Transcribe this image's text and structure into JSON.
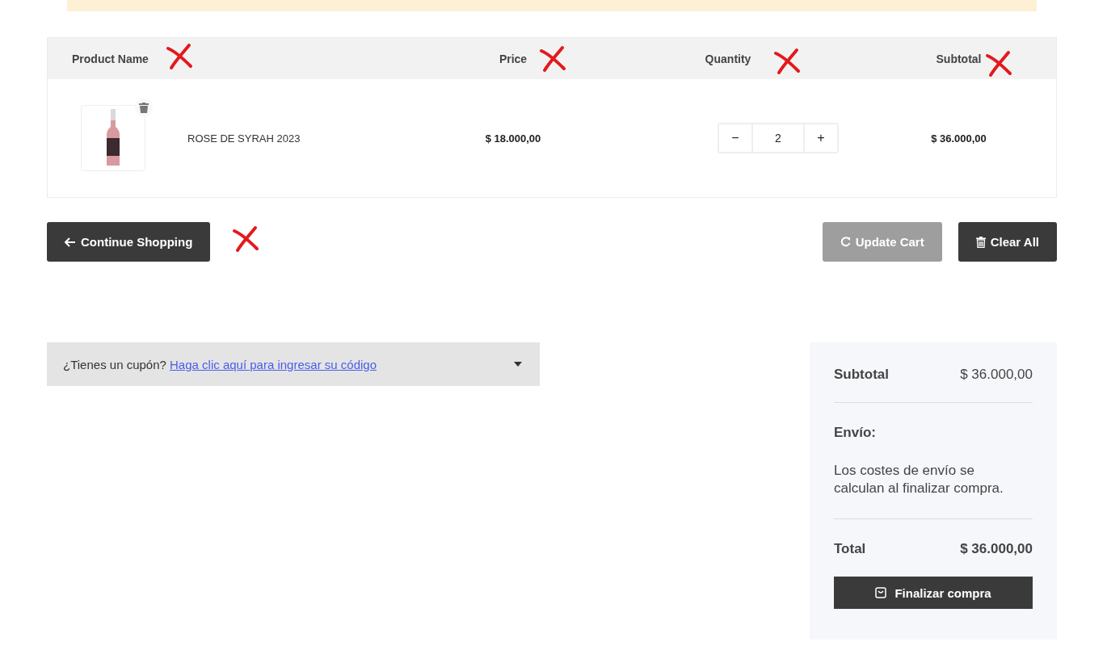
{
  "table": {
    "columns": [
      "Product Name",
      "Price",
      "Quantity",
      "Subtotal"
    ],
    "rows": [
      {
        "name": "ROSE DE SYRAH 2023",
        "price": "$ 18.000,00",
        "minus": "−",
        "quantity": "2",
        "plus": "+",
        "subtotal": "$ 36.000,00"
      }
    ]
  },
  "actions": {
    "continue": "Continue Shopping",
    "update": {
      "label": "Update Cart",
      "disabled": true
    },
    "clear": "Clear All"
  },
  "coupon": {
    "question": "¿Tienes un cupón?",
    "link": "Haga clic aquí para ingresar su código"
  },
  "totals": {
    "subtotal_label": "Subtotal",
    "subtotal": "$ 36.000,00",
    "shipping_label": "Envío:",
    "shipping_note": "Los costes de envío se calculan al finalizar compra.",
    "total_label": "Total",
    "total": "$ 36.000,00",
    "checkout": "Finalizar compra"
  }
}
